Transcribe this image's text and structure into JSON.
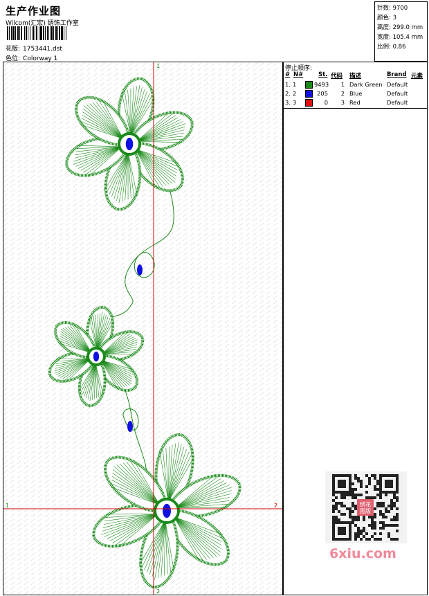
{
  "header": {
    "title": "生产作业图",
    "company": "Wilcom(汇宏) 绣饰工作室",
    "design_label": "花版:",
    "design_value": "1753441.dst",
    "colorway_label": "色位:",
    "colorway_value": "Colorway 1"
  },
  "specs": {
    "stitches": "针数: 9700",
    "colors": "颜色: 3",
    "height": "高度: 299.0 mm",
    "width": "宽度: 105.4 mm",
    "scale": "比例: 0.86"
  },
  "canvas": {
    "axis_v_top": "1",
    "axis_v_bottom": "2",
    "axis_h_left": "1",
    "axis_h_right": "2"
  },
  "color_table": {
    "title": "停止顺序:",
    "headers": {
      "num": "#",
      "n": "N#",
      "st": "St.",
      "code": "代码",
      "desc": "描述",
      "brand": "Brand",
      "elem": "元素"
    },
    "rows": [
      {
        "num": "1.",
        "n": "1",
        "st": "9493",
        "code": "1",
        "desc": "Dark Green",
        "brand": "Default",
        "color": "#1a8a1a"
      },
      {
        "num": "2.",
        "n": "2",
        "st": "205",
        "code": "2",
        "desc": "Blue",
        "brand": "Default",
        "color": "#1010e0"
      },
      {
        "num": "3.",
        "n": "3",
        "st": "0",
        "code": "3",
        "desc": "Red",
        "brand": "Default",
        "color": "#e01010"
      }
    ]
  },
  "watermark": {
    "text": "6xiu.com",
    "badge": "绣花图版"
  },
  "colors": {
    "thread_green": "#1a8a1a",
    "thread_blue": "#1010e0",
    "axis_red": "#cc0000"
  }
}
